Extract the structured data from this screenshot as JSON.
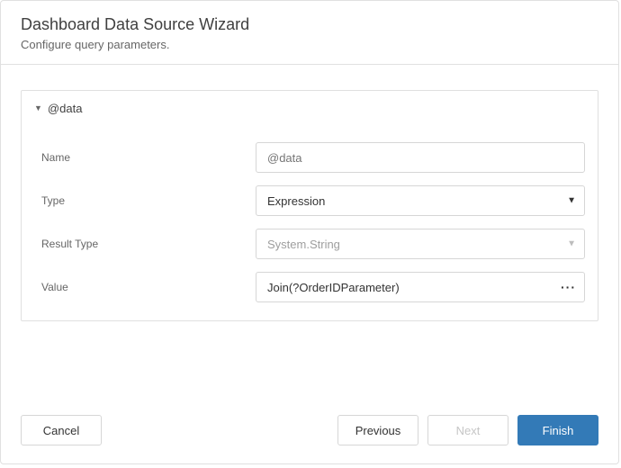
{
  "header": {
    "title": "Dashboard Data Source Wizard",
    "subtitle": "Configure query parameters."
  },
  "panel": {
    "name": "@data",
    "fields": {
      "name": {
        "label": "Name",
        "placeholder": "@data"
      },
      "type": {
        "label": "Type",
        "value": "Expression"
      },
      "resultType": {
        "label": "Result Type",
        "value": "System.String"
      },
      "value": {
        "label": "Value",
        "value": "Join(?OrderIDParameter)"
      }
    }
  },
  "footer": {
    "cancel": "Cancel",
    "previous": "Previous",
    "next": "Next",
    "finish": "Finish"
  }
}
